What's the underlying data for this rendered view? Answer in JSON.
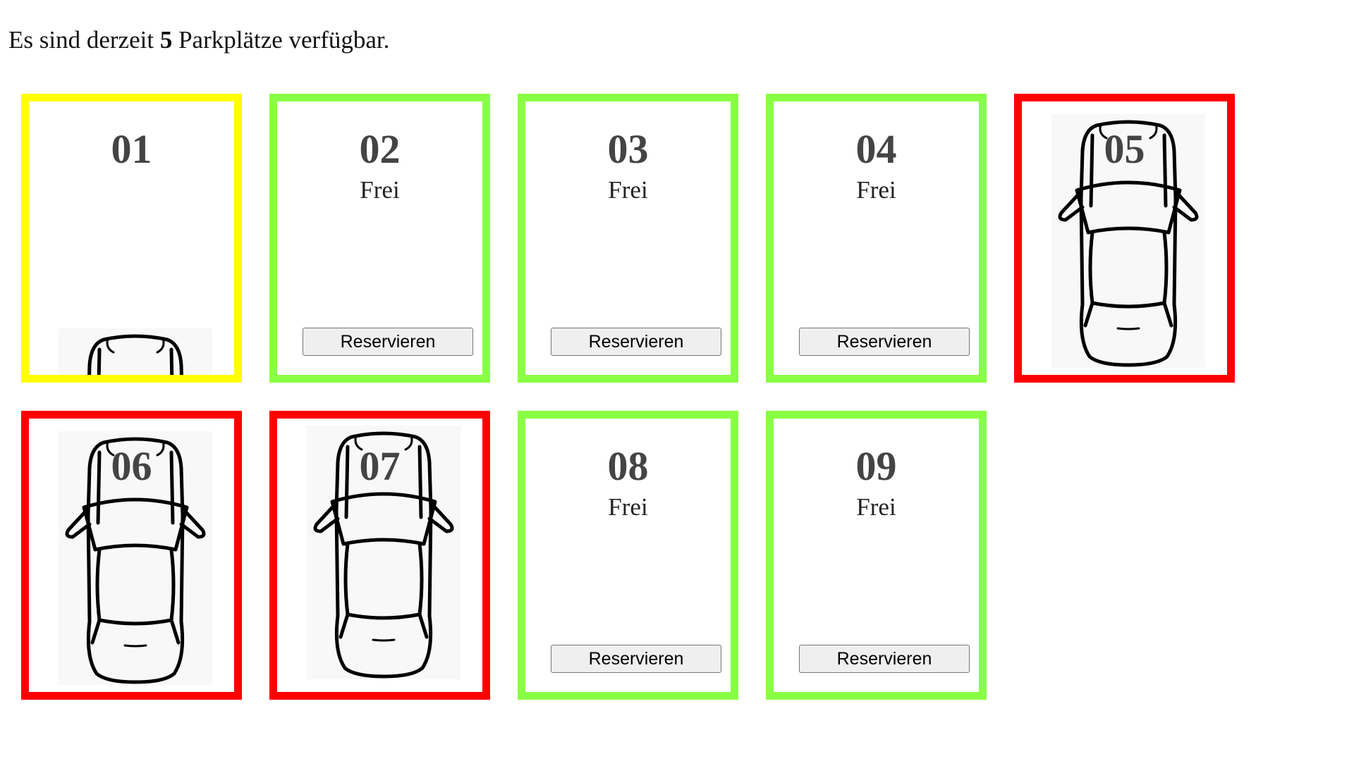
{
  "header": {
    "prefix": "Es sind derzeit",
    "count": "5",
    "suffix": "Parkplätze verfügbar."
  },
  "colors": {
    "free": "#88ff44",
    "reserved": "#ffff00",
    "occupied": "#ff0000"
  },
  "spots": [
    {
      "number": "01",
      "state": "reserved",
      "status": "",
      "button": "",
      "car_icon": "car-top-view-icon"
    },
    {
      "number": "02",
      "state": "free",
      "status": "Frei",
      "button": "Reservieren",
      "car_icon": ""
    },
    {
      "number": "03",
      "state": "free",
      "status": "Frei",
      "button": "Reservieren",
      "car_icon": ""
    },
    {
      "number": "04",
      "state": "free",
      "status": "Frei",
      "button": "Reservieren",
      "car_icon": ""
    },
    {
      "number": "05",
      "state": "occupied",
      "status": "",
      "button": "",
      "car_icon": "car-top-view-icon"
    },
    {
      "number": "06",
      "state": "occupied",
      "status": "",
      "button": "",
      "car_icon": "car-top-view-icon"
    },
    {
      "number": "07",
      "state": "occupied",
      "status": "",
      "button": "",
      "car_icon": "car-top-view-icon"
    },
    {
      "number": "08",
      "state": "free",
      "status": "Frei",
      "button": "Reservieren",
      "car_icon": ""
    },
    {
      "number": "09",
      "state": "free",
      "status": "Frei",
      "button": "Reservieren",
      "car_icon": ""
    }
  ]
}
